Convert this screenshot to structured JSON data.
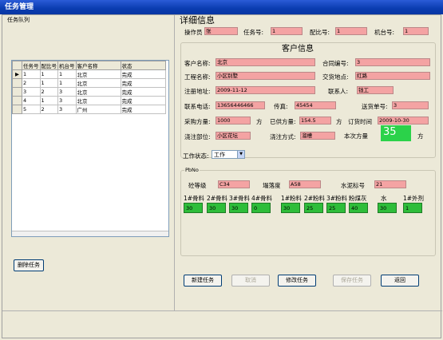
{
  "window": {
    "title": "任务管理"
  },
  "left": {
    "group_label": "任务队列",
    "table": {
      "columns": [
        "任务号",
        "配比号",
        "机台号",
        "客户名称",
        "状态"
      ],
      "rows": [
        [
          "1",
          "1",
          "1",
          "北京",
          "完成"
        ],
        [
          "2",
          "1",
          "1",
          "北京",
          "完成"
        ],
        [
          "3",
          "2",
          "3",
          "北京",
          "完成"
        ],
        [
          "4",
          "1",
          "3",
          "北京",
          "完成"
        ],
        [
          "5",
          "2",
          "3",
          "广州",
          "完成"
        ]
      ]
    },
    "delete_button": "删除任务"
  },
  "detail": {
    "title": "详细信息",
    "operator_label": "操作员",
    "operator_value": "张",
    "task_no_label": "任务号:",
    "task_no_value": "1",
    "recipe_label": "配比号:",
    "recipe_value": "1",
    "machine_label": "机台号:",
    "machine_value": "1",
    "customer_title": "客户信息",
    "customer_name_label": "客户名称:",
    "customer_name_value": "北京",
    "contract_label": "合同编号:",
    "contract_value": "3",
    "project_label": "工程名称:",
    "project_value": "小区别墅",
    "delivery_place_label": "交货地点:",
    "delivery_place_value": "红路",
    "reg_addr_label": "注册地址:",
    "reg_addr_value": "2009-11-12",
    "contact_label": "联系人:",
    "contact_value": "钱工",
    "phone_label": "联系电话:",
    "phone_value": "13656446466",
    "fax_label": "传真:",
    "fax_value": "45454",
    "delivery_no_label": "送货单号:",
    "delivery_no_value": "3",
    "purchase_label": "采购方量:",
    "purchase_value": "1000",
    "purchase_unit": "方",
    "supplied_label": "已供方量:",
    "supplied_value": "154.5",
    "supplied_unit": "方",
    "order_time_label": "订货时间",
    "order_time_value": "2009-10-30",
    "pour_part_label": "浇注部位:",
    "pour_part_value": "小区花坛",
    "pour_method_label": "浇注方式:",
    "pour_method_value": "溜槽",
    "this_amount_label": "本次方量",
    "this_amount_value": "35",
    "this_amount_unit": "方",
    "status_label": "工作状态:",
    "status_value": "工作"
  },
  "pbno": {
    "group_label": "PbNo",
    "grade_label": "砼等级",
    "grade_value": "C34",
    "slump_label": "塌落度",
    "slump_value": "A58",
    "cement_label": "水泥标号",
    "cement_value": "21",
    "materials": [
      {
        "label": "1#骨料",
        "value": "30"
      },
      {
        "label": "2#骨料",
        "value": "30"
      },
      {
        "label": "3#骨料",
        "value": "30"
      },
      {
        "label": "4#骨料",
        "value": "0"
      },
      {
        "label": "1#粉料",
        "value": "30"
      },
      {
        "label": "2#粉料",
        "value": "25"
      },
      {
        "label": "3#粉料",
        "value": "25"
      },
      {
        "label": "粉煤灰",
        "value": "40"
      },
      {
        "label": "水",
        "value": "30"
      },
      {
        "label": "1#外剂",
        "value": "1"
      }
    ]
  },
  "buttons": {
    "new": "新建任务",
    "cancel": "取消",
    "modify": "修改任务",
    "save": "保存任务",
    "back": "返回"
  },
  "colors": {
    "field": "#f4a3a3",
    "green": "#2ebd3a",
    "titlebar": "#0a3cb0"
  }
}
